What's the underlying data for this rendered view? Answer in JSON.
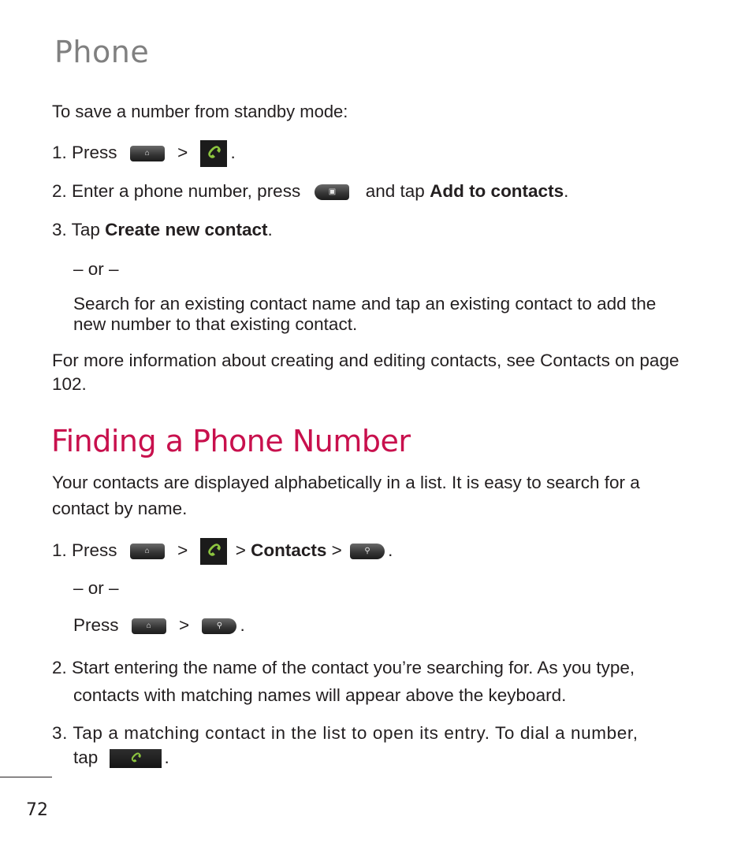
{
  "section_title": "Phone",
  "save_number": {
    "heading": "To save a number from standby mode:",
    "step1_prefix": "1. Press",
    "step1_sep": ">",
    "step1_end": ".",
    "step2_prefix": "2. Enter a phone number, press",
    "step2_mid": "and tap",
    "step2_bold": "Add to contacts",
    "step2_end": ".",
    "step3_prefix": "3. Tap",
    "step3_bold": "Create new contact",
    "step3_end": ".",
    "or": "– or –",
    "alt_line1": "Search for an existing contact name and tap an existing contact to add the",
    "alt_line2": "new number to that existing contact.",
    "info_line1": "For more information about creating and editing contacts, see Contacts on page",
    "info_line2": "102."
  },
  "finding": {
    "heading": "Finding a Phone Number",
    "intro_line1": "Your contacts are displayed alphabetically in a list. It is easy to search for a",
    "intro_line2": "contact by name.",
    "step1_prefix": "1. Press",
    "sep": ">",
    "contacts_sep": ">",
    "contacts_bold": "Contacts",
    "after_contacts": ">",
    "end": ".",
    "or": "– or –",
    "alt_press": "Press",
    "step2_line1": "2. Start entering the name of the contact you’re searching for. As you type,",
    "step2_line2": "contacts with matching names will appear above the keyboard.",
    "step3_line1": "3. Tap a matching contact in the list to open its entry. To dial a number,",
    "step3_line2": "tap"
  },
  "icons": {
    "home_key": "home-key-icon",
    "menu_key": "menu-key-icon",
    "search_key": "search-key-icon",
    "phone_app": "phone-app-icon",
    "call_button": "call-button-icon"
  },
  "colors": {
    "heading_accent": "#c8104d",
    "section_title": "#808080",
    "phone_green": "#8dc63f"
  },
  "page_number": "72"
}
